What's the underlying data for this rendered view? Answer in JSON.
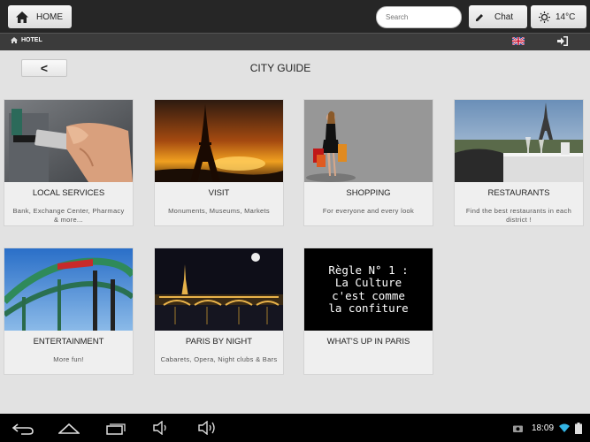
{
  "topbar": {
    "home_label": "HOME",
    "search_placeholder": "Search",
    "chat_label": "Chat",
    "temperature": "14°C"
  },
  "subbar": {
    "hotel_label": "HOTEL"
  },
  "header": {
    "back_label": "<",
    "title": "CITY GUIDE"
  },
  "cards": [
    {
      "title": "LOCAL SERVICES",
      "desc": "Bank, Exchange Center, Pharmacy & more..."
    },
    {
      "title": "VISIT",
      "desc": "Monuments, Museums, Markets"
    },
    {
      "title": "SHOPPING",
      "desc": "For everyone and every look"
    },
    {
      "title": "RESTAURANTS",
      "desc": "Find the best restaurants in each district !"
    },
    {
      "title": "ENTERTAINMENT",
      "desc": "More fun!"
    },
    {
      "title": "PARIS BY NIGHT",
      "desc": "Cabarets, Opera, Night clubs & Bars"
    },
    {
      "title": "WHAT'S UP IN PARIS",
      "desc": ""
    }
  ],
  "quote_lines": [
    "Règle N° 1 :",
    "La Culture",
    "c'est comme",
    "la confiture"
  ],
  "statusbar": {
    "time": "18:09"
  },
  "colors": {
    "topbar": "#262626",
    "subbar": "#3b3b3b",
    "background": "#e2e2e2",
    "card": "#efefef"
  }
}
